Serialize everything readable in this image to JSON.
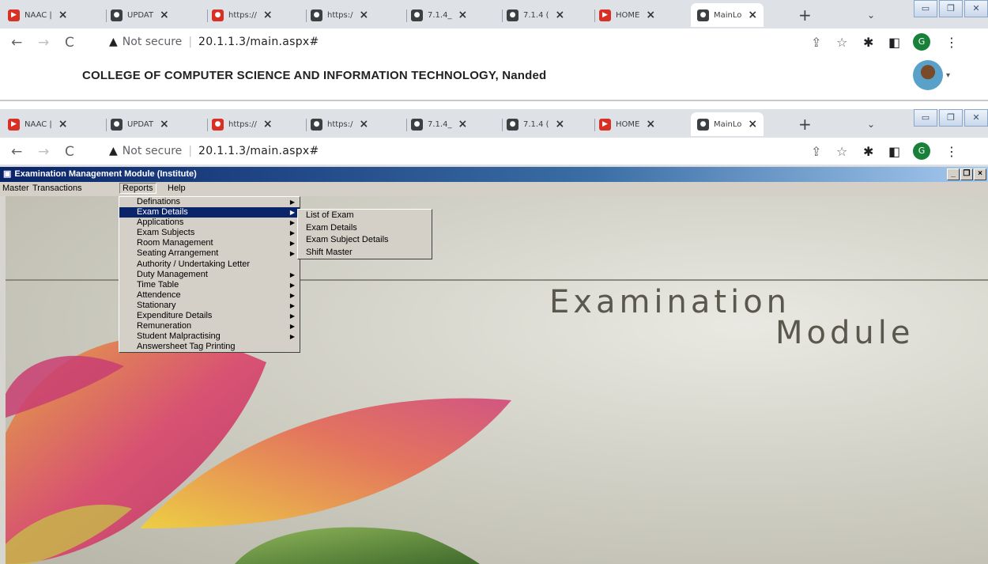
{
  "browser": {
    "tabs": [
      {
        "label": "NAAC |",
        "icon": "pdf-icon"
      },
      {
        "label": "UPDAT",
        "icon": "globe-icon"
      },
      {
        "label": "https://",
        "icon": "red-globe-icon"
      },
      {
        "label": "https:/",
        "icon": "globe-icon"
      },
      {
        "label": "7.1.4_",
        "icon": "globe-icon"
      },
      {
        "label": "7.1.4 (",
        "icon": "globe-icon"
      },
      {
        "label": "HOME",
        "icon": "pdf-icon"
      },
      {
        "label": "MainLo",
        "icon": "globe-icon"
      }
    ],
    "close_glyph": "×",
    "new_tab": "+",
    "address": {
      "not_secure": "Not secure",
      "url": "20.1.1.3/main.aspx#"
    },
    "profile_initial": "G"
  },
  "college": {
    "title": "COLLEGE OF COMPUTER SCIENCE AND INFORMATION TECHNOLOGY, Nanded"
  },
  "app": {
    "title": "Examination Management Module (Institute)",
    "menu": [
      "Master",
      "Transactions",
      "Reports",
      "Help"
    ],
    "reports_menu": [
      {
        "label": "Definations",
        "submenu": true
      },
      {
        "label": "Exam Details",
        "submenu": true,
        "selected": true
      },
      {
        "label": "Applications",
        "submenu": true
      },
      {
        "label": "Exam Subjects",
        "submenu": true
      },
      {
        "label": "Room Management",
        "submenu": true
      },
      {
        "label": "Seating Arrangement",
        "submenu": true
      },
      {
        "label": "Authority / Undertaking Letter",
        "submenu": false
      },
      {
        "label": "Duty Management",
        "submenu": true
      },
      {
        "label": "Time Table",
        "submenu": true
      },
      {
        "label": "Attendence",
        "submenu": true
      },
      {
        "label": "Stationary",
        "submenu": true
      },
      {
        "label": "Expenditure Details",
        "submenu": true
      },
      {
        "label": "Remuneration",
        "submenu": true
      },
      {
        "label": "Student Malpractising",
        "submenu": true
      },
      {
        "label": "Answersheet Tag Printing",
        "submenu": false
      }
    ],
    "exam_details_submenu": [
      "List of Exam",
      "Exam Details",
      "Exam Subject Details",
      "Shift Master"
    ],
    "splash": {
      "line1": "Examination",
      "line2": "Module"
    }
  },
  "colors": {
    "titlebar": "#0a246a",
    "menu_bg": "#d4d0c8",
    "highlight": "#0a246a"
  }
}
